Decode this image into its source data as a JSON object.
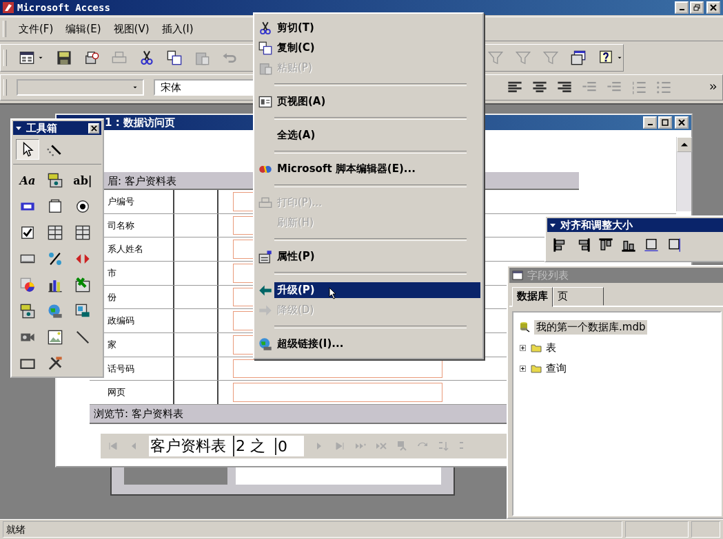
{
  "app": {
    "title": "Microsoft Access"
  },
  "menu_bar": [
    {
      "label": "文件(F)"
    },
    {
      "label": "编辑(E)"
    },
    {
      "label": "视图(V)"
    },
    {
      "label": "插入(I)"
    }
  ],
  "format_toolbar": {
    "font": "宋体"
  },
  "page_window": {
    "title": "1 : 数据访问页",
    "header_section": "眉: 客户资料表",
    "field_labels": [
      "户编号",
      "司名称",
      "系人姓名",
      "市",
      "份",
      "政编码",
      "家",
      "话号码",
      "网页"
    ],
    "browse_section": "浏览节: 客户资料表",
    "navigator": {
      "source": "客户资料表",
      "position": "2 之",
      "count": "0"
    }
  },
  "toolbox": {
    "title": "工具箱",
    "mode_buttons": [
      {
        "selected": true
      },
      {
        "selected": false
      }
    ],
    "tools": [
      {
        "kind": "glyph",
        "label": "Aa"
      },
      {
        "kind": "icon"
      },
      {
        "kind": "glyph",
        "label": "ab|"
      },
      {
        "kind": "icon"
      },
      {
        "kind": "icon"
      },
      {
        "kind": "icon"
      },
      {
        "kind": "icon"
      },
      {
        "kind": "icon"
      },
      {
        "kind": "icon"
      },
      {
        "kind": "icon"
      },
      {
        "kind": "icon"
      },
      {
        "kind": "icon"
      },
      {
        "kind": "icon"
      },
      {
        "kind": "icon"
      },
      {
        "kind": "icon"
      },
      {
        "kind": "icon"
      },
      {
        "kind": "icon"
      },
      {
        "kind": "icon"
      },
      {
        "kind": "icon"
      },
      {
        "kind": "icon"
      },
      {
        "kind": "icon"
      },
      {
        "kind": "icon"
      },
      {
        "kind": "icon"
      }
    ]
  },
  "context_menu": {
    "items": [
      {
        "kind": "item",
        "label": "剪切(T)",
        "disabled": false,
        "selected": false
      },
      {
        "kind": "item",
        "label": "复制(C)",
        "disabled": false,
        "selected": false
      },
      {
        "kind": "item",
        "label": "粘贴(P)",
        "disabled": true,
        "selected": false
      },
      {
        "kind": "separator"
      },
      {
        "kind": "item",
        "label": "页视图(A)",
        "disabled": false,
        "selected": false
      },
      {
        "kind": "separator"
      },
      {
        "kind": "item",
        "label": "全选(A)",
        "disabled": false,
        "selected": false
      },
      {
        "kind": "separator"
      },
      {
        "kind": "item",
        "label": "Microsoft 脚本编辑器(E)...",
        "disabled": false,
        "selected": false
      },
      {
        "kind": "separator"
      },
      {
        "kind": "item",
        "label": "打印(P)...",
        "disabled": true,
        "selected": false
      },
      {
        "kind": "item",
        "label": "刷新(H)",
        "disabled": true,
        "selected": false
      },
      {
        "kind": "separator"
      },
      {
        "kind": "item",
        "label": "属性(P)",
        "disabled": false,
        "selected": false
      },
      {
        "kind": "separator"
      },
      {
        "kind": "item",
        "label": "升级(P)",
        "disabled": false,
        "selected": true
      },
      {
        "kind": "item",
        "label": "降级(D)",
        "disabled": true,
        "selected": false
      },
      {
        "kind": "separator"
      },
      {
        "kind": "item",
        "label": "超级链接(I)...",
        "disabled": false,
        "selected": false
      }
    ]
  },
  "align_toolbar": {
    "title": "对齐和调整大小"
  },
  "field_list": {
    "title": "字段列表",
    "active": false,
    "tabs": [
      {
        "label": "数据库",
        "selected": true
      },
      {
        "label": "页",
        "selected": false
      }
    ],
    "tree": [
      {
        "label": "我的第一个数据库.mdb",
        "selected": true,
        "children": [
          {
            "label": "表",
            "expanded": false,
            "selected": false
          },
          {
            "label": "查询",
            "expanded": false,
            "selected": false
          }
        ]
      }
    ]
  },
  "status_bar": {
    "text": "就绪"
  }
}
